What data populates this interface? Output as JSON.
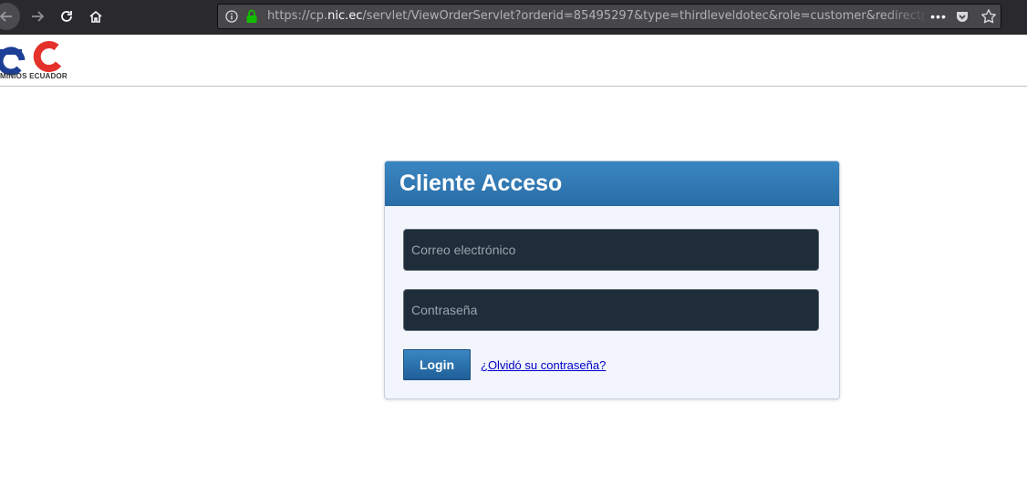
{
  "browser": {
    "url_prefix": "https://cp.",
    "url_domain": "nic.ec",
    "url_suffix": "/servlet/ViewOrderServlet?orderid=85495297&type=thirdleveldotec&role=customer&redirectpage=",
    "more_label": "•••"
  },
  "site": {
    "logo_subtitle": "MINIOS ECUADOR",
    "brand_colors": {
      "blue": "#1d3f95",
      "red": "#e4322b"
    }
  },
  "login": {
    "title": "Cliente Acceso",
    "email_placeholder": "Correo electrónico",
    "password_placeholder": "Contraseña",
    "login_label": "Login",
    "forgot_label": "¿Olvidó su contraseña?"
  },
  "icons": [
    "back-icon",
    "forward-icon",
    "reload-icon",
    "home-icon",
    "info-icon",
    "lock-icon",
    "more-icon",
    "pocket-icon",
    "star-icon"
  ]
}
